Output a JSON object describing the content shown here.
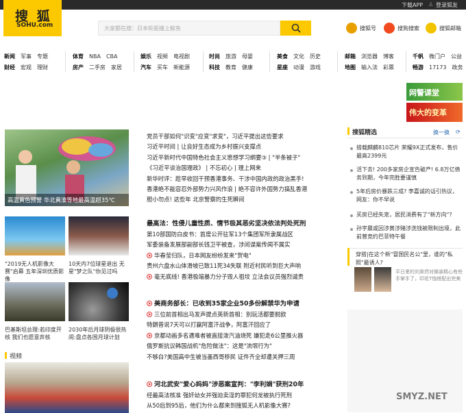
{
  "topbar": {
    "download": "下载APP",
    "login": "登录狐友"
  },
  "logo": {
    "cn": "搜 狐",
    "en": "SOHU.com"
  },
  "search": {
    "placeholder": "大家都在搜：日本轮船撞上鲸鱼"
  },
  "quick": {
    "sohuhao": "搜狐号",
    "video": "搜狗搜索",
    "mail": "搜狐邮箱"
  },
  "nav": {
    "g1": {
      "r1": [
        "新闻",
        "军事",
        "专题"
      ],
      "r2": [
        "财经",
        "宏观",
        "理财"
      ]
    },
    "g2": {
      "r1": [
        "体育",
        "NBA",
        "CBA"
      ],
      "r2": [
        "房产",
        "二手房",
        "家居"
      ]
    },
    "g3": {
      "r1": [
        "娱乐",
        "视频",
        "电视剧"
      ],
      "r2": [
        "汽车",
        "买车",
        "新能源"
      ]
    },
    "g4": {
      "r1": [
        "时尚",
        "旅游",
        "母婴"
      ],
      "r2": [
        "科技",
        "教育",
        "健康"
      ]
    },
    "g5": {
      "r1": [
        "美食",
        "文化",
        "历史"
      ],
      "r2": [
        "星座",
        "动漫",
        "游戏"
      ]
    },
    "g6": {
      "r1": [
        "邮箱",
        "浏览器",
        "博客"
      ],
      "r2": [
        "地图",
        "输入法",
        "彩票"
      ]
    },
    "g7": {
      "r1": [
        "千帆",
        "微门户",
        "公益"
      ],
      "r2": [
        "畅游",
        "17173",
        "政务"
      ]
    }
  },
  "ads": {
    "a1": "网警课堂",
    "a2": "伟大的变革"
  },
  "hero": {
    "caption": "高温黄色预警 华北黄淮等地最高温超35℃"
  },
  "thumbs": [
    {
      "caption": "\"2019无人机影像大赛\"启幕 五年深圳优质影像"
    },
    {
      "caption": "10天内7位球星退出 无星\"梦之队\"你见过吗"
    },
    {
      "caption": "巴基斯坦总理:若印度开核 我们也愿意弃核"
    },
    {
      "caption": "2030年后月球阴极很热闹:盘点各国月球计划"
    }
  ],
  "video": {
    "label": "视频"
  },
  "news": {
    "top": [
      "党员干部如何\"识变\"应变\"求变\"，习近平提出这些要求",
      "习近平时间 | 让良好生态成为乡村振兴支撑点",
      "习近平新时代中国特色社会主义思想学习纲要③ | \"半条被子\"",
      "《习近平谈治国理政》 | 不忘初心 | 理上网来",
      "新华时评：趁早收回干预香港事务、干涉中国内政的政治黑手!",
      "香港绝不能容忍外部势力兴风作浪 | 绝不容许外国势力搞乱香港",
      "胆小勿点! 这些年 北京警察的生死瞬间"
    ],
    "h1": "最高法：性侵儿童性质、情节极其恶劣坚决依法判处死刑",
    "m1": [
      "第10部国防白皮书：首度公开驻军13个集团军所隶属战区",
      "军委装备发展部副部长钱卫平被查，涉间谍案传闻不属实",
      "华春莹归队，日本网友纷纷发来\"贺电\"",
      "贵州六盘水山体滑坡已致11死34失联 附近村民听到巨大声响",
      "毫无底线! 香港极端暴力分子毁人祖坟 立法会议员强烈谴责"
    ],
    "h2": "美商务部长：已收到35家企业50多份解禁华为申请",
    "m2": [
      "三位前首相出马发声提点英新首相：别玩活都要脱欧",
      "特朗普说7天可以打赢阿富汗战争，阿富汗回应了",
      "京都动画多名遇难者被直接泼汽油烧死 嫌犯走6公里推火器",
      "俄罗斯抗议韩国战机\"危险做法\"：这是\"流氓行为\"",
      "不够白?美国高中生被当墨西哥移民 证件齐全却遭关押三周"
    ],
    "h3": "河北武安\"爱心妈妈\"涉恶案宣判：\"李利娟\"获刑20年",
    "m3": [
      "经最高法核准 强奸幼女并强迫卖淫的罪犯何龙被执行死刑",
      "从50后到95后，他们为什么都来到搜狐无人机影像大赛?"
    ]
  },
  "right": {
    "title": "搜狐精选",
    "more": "换一换",
    "items": [
      "搭载麒麟810芯片 荣耀9X正式发布，售价最高2399元",
      "活下去! 200多家房企宣告破产! 6.8万亿债务到期，今年完胜要谨慎",
      "5年后房价暴跌三成? 李嘉诚的话引热议，网友：你不早说",
      "买房已经失宠，居民消费有了\"新方向\"?",
      "孙宇晨或因涉黄涉赌涉洗钱被限制出境，此前曾竞约巴菲特午餐"
    ],
    "feature_title": "穿搭|在这个新\"冒国民名公\"里，谁的\"私照\"最诱人?",
    "feature_text": "平日里的刘昊然对换装精心有些手掌手了，印花T恤搭配出完美"
  },
  "watermark": "SMYZ.NET"
}
